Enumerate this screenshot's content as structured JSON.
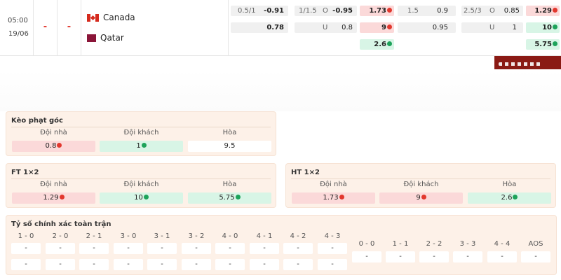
{
  "match": {
    "time": "05:00",
    "date": "19/06",
    "home_score": "-",
    "away_score": "-",
    "home_team": "Canada",
    "away_team": "Qatar"
  },
  "odds": {
    "row1": {
      "hcp_line": "0.5/1",
      "hcp_home": "-0.91",
      "ou_line": "1/1.5",
      "ou_o_label": "O",
      "ou_over": "-0.95",
      "x12_home": "1.73",
      "ht_hcp_line": "1.5",
      "ht_hcp_home": "0.9",
      "ht_ou_line": "2.5/3",
      "ht_o_label": "O",
      "ht_ou_over": "0.85",
      "ht_x12_home": "1.29"
    },
    "row2": {
      "hcp_away": "0.78",
      "ou_u_label": "U",
      "ou_under": "0.8",
      "x12_away": "9",
      "ht_hcp_away": "0.95",
      "ht_u_label": "U",
      "ht_ou_under": "1",
      "ht_x12_away": "10"
    },
    "row3": {
      "x12_draw": "2.6",
      "ht_x12_draw": "5.75"
    }
  },
  "corner": {
    "title": "Kèo phạt góc",
    "home_label": "Đội nhà",
    "away_label": "Đội khách",
    "draw_label": "Hòa",
    "home": "0.8",
    "away": "1",
    "draw": "9.5"
  },
  "ft": {
    "title": "FT 1×2",
    "home_label": "Đội nhà",
    "away_label": "Đội khách",
    "draw_label": "Hòa",
    "home": "1.29",
    "away": "10",
    "draw": "5.75"
  },
  "ht": {
    "title": "HT 1×2",
    "home_label": "Đội nhà",
    "away_label": "Đội khách",
    "draw_label": "Hòa",
    "home": "1.73",
    "away": "9",
    "draw": "2.6"
  },
  "correct_score": {
    "title": "Tỷ số chính xác toàn trận",
    "home_wins": [
      {
        "label": "1 - 0",
        "v1": "-",
        "v2": "-"
      },
      {
        "label": "2 - 0",
        "v1": "-",
        "v2": "-"
      },
      {
        "label": "2 - 1",
        "v1": "-",
        "v2": "-"
      },
      {
        "label": "3 - 0",
        "v1": "-",
        "v2": "-"
      },
      {
        "label": "3 - 1",
        "v1": "-",
        "v2": "-"
      },
      {
        "label": "3 - 2",
        "v1": "-",
        "v2": "-"
      },
      {
        "label": "4 - 0",
        "v1": "-",
        "v2": "-"
      },
      {
        "label": "4 - 1",
        "v1": "-",
        "v2": "-"
      },
      {
        "label": "4 - 2",
        "v1": "-",
        "v2": "-"
      },
      {
        "label": "4 - 3",
        "v1": "-",
        "v2": "-"
      }
    ],
    "draws": [
      {
        "label": "0 - 0",
        "v": "-"
      },
      {
        "label": "1 - 1",
        "v": "-"
      },
      {
        "label": "2 - 2",
        "v": "-"
      },
      {
        "label": "3 - 3",
        "v": "-"
      },
      {
        "label": "4 - 4",
        "v": "-"
      },
      {
        "label": "AOS",
        "v": "-"
      }
    ]
  },
  "colors": {
    "down_arrow": "#e2382e",
    "up_arrow": "#1da35a",
    "card_bg": "#fdf1e8",
    "odds_drop_bg": "#fbd9d9",
    "odds_rise_bg": "#d8f5e6"
  },
  "icons": {
    "down": "arrow-down-circle-icon",
    "up": "arrow-up-circle-icon",
    "home_flag": "canada-flag-icon",
    "away_flag": "qatar-flag-icon"
  }
}
